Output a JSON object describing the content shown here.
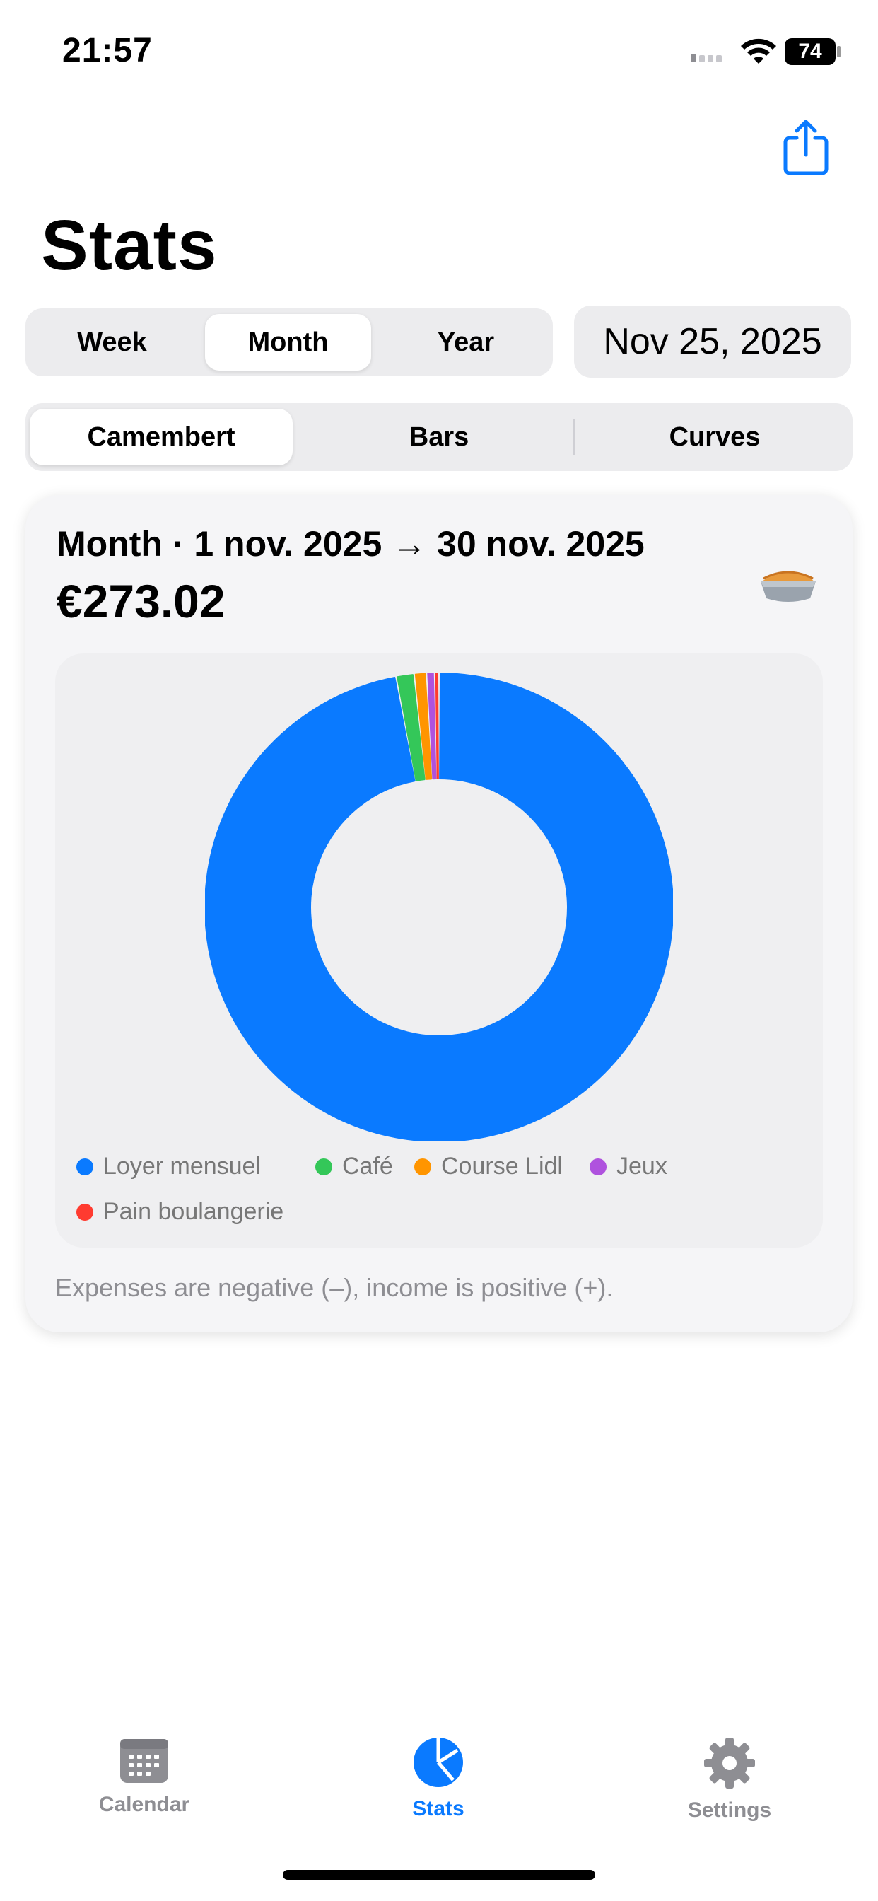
{
  "status_bar": {
    "time": "21:57",
    "battery": "74"
  },
  "title": "Stats",
  "period_tabs": [
    {
      "label": "Week",
      "active": false
    },
    {
      "label": "Month",
      "active": true
    },
    {
      "label": "Year",
      "active": false
    }
  ],
  "date": "Nov 25, 2025",
  "chart_tabs": [
    {
      "label": "Camembert",
      "active": true
    },
    {
      "label": "Bars",
      "active": false
    },
    {
      "label": "Curves",
      "active": false
    }
  ],
  "card": {
    "period": "Month · 1 nov. 2025 → 30 nov. 2025",
    "total": "€273.02",
    "footnote": "Expenses are negative (–), income is positive (+)."
  },
  "chart_data": {
    "type": "pie",
    "donut": true,
    "categories": [
      "Loyer mensuel",
      "Café",
      "Course Lidl",
      "Jeux",
      "Pain boulangerie"
    ],
    "values": [
      265.0,
      3.4,
      2.3,
      1.5,
      0.82
    ],
    "colors": [
      "#0A7AFF",
      "#34C759",
      "#FF9500",
      "#AF52DE",
      "#FF3B30"
    ],
    "legend_position": "bottom"
  },
  "tabbar": [
    {
      "label": "Calendar",
      "icon": "calendar-icon",
      "active": false
    },
    {
      "label": "Stats",
      "icon": "pie-chart-icon",
      "active": true
    },
    {
      "label": "Settings",
      "icon": "gear-icon",
      "active": false
    }
  ],
  "colors": {
    "accent": "#0A7AFF",
    "inactive": "#8E8E93"
  }
}
